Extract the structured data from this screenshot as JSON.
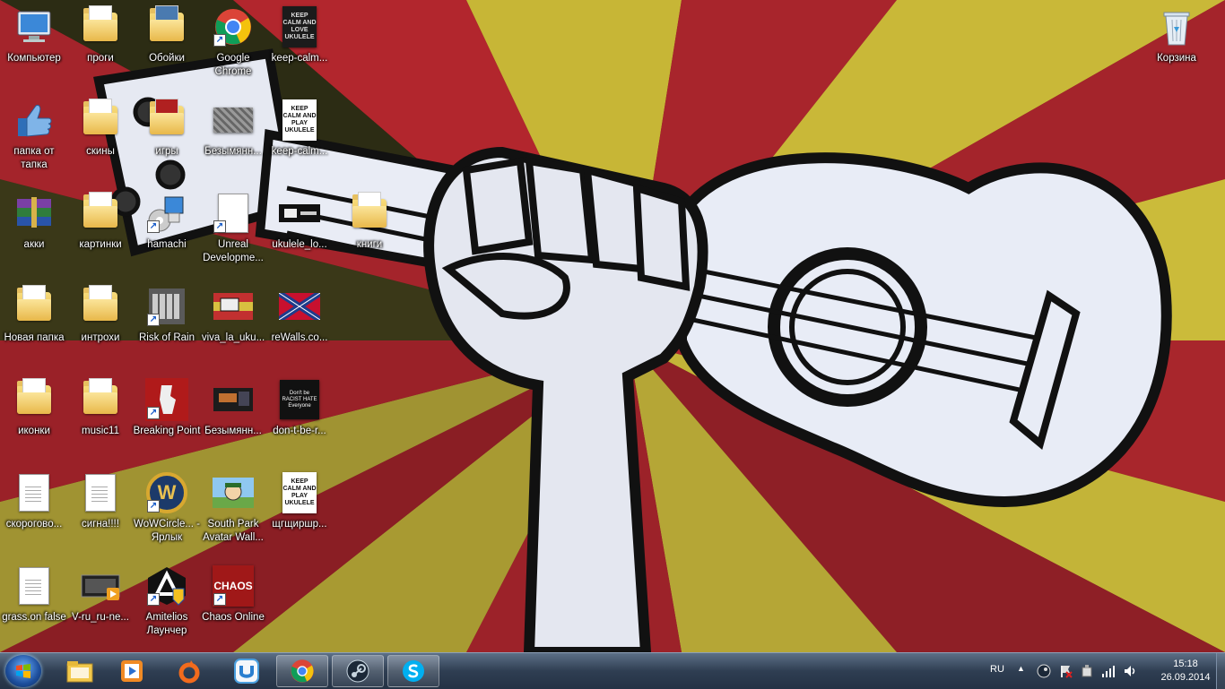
{
  "desktop": {
    "icons": [
      {
        "label": "Компьютер"
      },
      {
        "label": "проги"
      },
      {
        "label": "Обойки"
      },
      {
        "label": "Google Chrome"
      },
      {
        "label": "keep-calm..."
      },
      {
        "label": "Корзина"
      },
      {
        "label": "папка от тапка"
      },
      {
        "label": "скины"
      },
      {
        "label": "игры"
      },
      {
        "label": "Безымянн..."
      },
      {
        "label": "keep-calm..."
      },
      {
        "label": "акки"
      },
      {
        "label": "картинки"
      },
      {
        "label": "hamachi"
      },
      {
        "label": "Unreal Developme..."
      },
      {
        "label": "ukulele_lo..."
      },
      {
        "label": "книги"
      },
      {
        "label": "Новая папка"
      },
      {
        "label": "интрохи"
      },
      {
        "label": "Risk of Rain"
      },
      {
        "label": "viva_la_uku..."
      },
      {
        "label": "reWalls.co..."
      },
      {
        "label": "иконки"
      },
      {
        "label": "music11"
      },
      {
        "label": "Breaking Point"
      },
      {
        "label": "Безымянн..."
      },
      {
        "label": "don-t-be-r..."
      },
      {
        "label": "скороговo..."
      },
      {
        "label": "сигна!!!!"
      },
      {
        "label": "WoWCircle... - Ярлык"
      },
      {
        "label": "South Park Avatar Wall..."
      },
      {
        "label": "щгщиршр..."
      },
      {
        "label": "grass.on false"
      },
      {
        "label": "V-ru_ru-ne..."
      },
      {
        "label": "Amitelios Лаунчер"
      },
      {
        "label": "Chaos Online"
      }
    ],
    "thumb_text": {
      "keep_calm_love": "KEEP CALM AND LOVE UKULELE",
      "keep_calm_play": "KEEP CALM AND PLAY UKULELE",
      "dont_be_racist": "Don't be RACIST HATE Everyone",
      "chaos": "CHAOS",
      "wow": "W"
    }
  },
  "taskbar": {
    "pinned": [
      {
        "name": "explorer"
      },
      {
        "name": "media-player"
      },
      {
        "name": "origin"
      },
      {
        "name": "uplay"
      },
      {
        "name": "google-chrome"
      },
      {
        "name": "steam"
      },
      {
        "name": "skype"
      }
    ],
    "tray": {
      "language": "RU",
      "time": "15:18",
      "date": "26.09.2014"
    }
  },
  "colors": {
    "wall_red": "#a8262c",
    "wall_yellow": "#c9b838",
    "wall_dark": "#3a3a18",
    "ukulele": "#e8ecf6",
    "taskbar": "#2f3e52"
  }
}
